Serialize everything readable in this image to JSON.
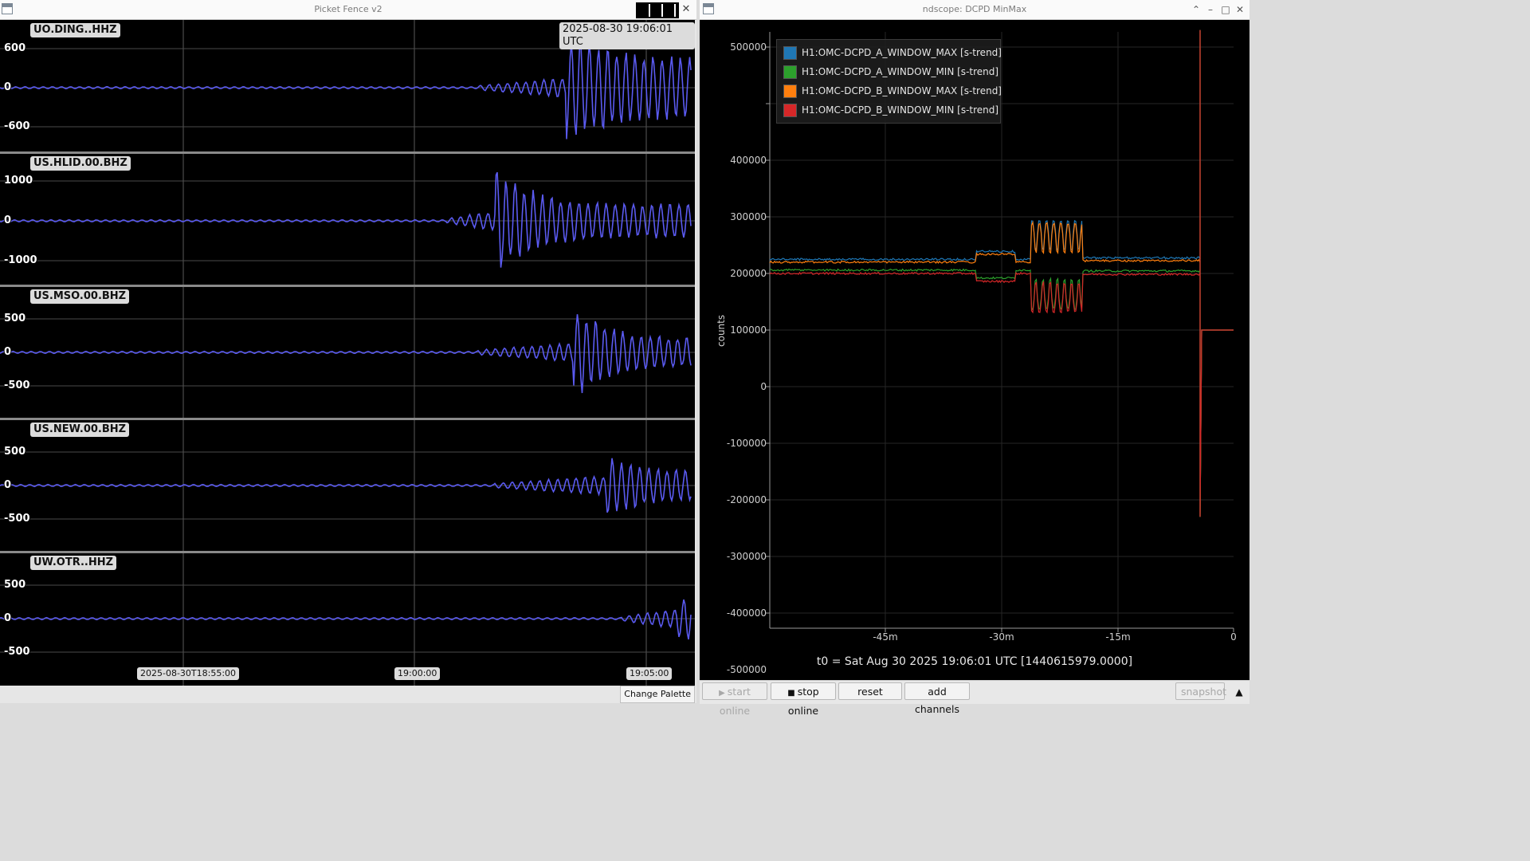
{
  "picket_fence": {
    "window_title": "Picket Fence v2",
    "timestamp": "2025-08-30 19:06:01 UTC",
    "change_palette_label": "Change Palette",
    "trace_color": "#5a5af0",
    "x_ticks": [
      "2025-08-30T18:55:00",
      "19:00:00",
      "19:05:00"
    ],
    "channels": [
      {
        "name": "UO.DING..HHZ",
        "ticks": [
          "600",
          "0",
          "-600"
        ]
      },
      {
        "name": "US.HLID.00.BHZ",
        "ticks": [
          "1000",
          "0",
          "-1000"
        ]
      },
      {
        "name": "US.MSO.00.BHZ",
        "ticks": [
          "500",
          "0",
          "-500"
        ]
      },
      {
        "name": "US.NEW.00.BHZ",
        "ticks": [
          "500",
          "0",
          "-500"
        ]
      },
      {
        "name": "UW.OTR..HHZ",
        "ticks": [
          "500",
          "0",
          "-500"
        ]
      }
    ]
  },
  "ndscope": {
    "window_title": "ndscope: DCPD MinMax",
    "y_axis_label": "counts",
    "y_ticks": [
      "500000",
      "400000",
      "300000",
      "200000",
      "100000",
      "0",
      "-100000",
      "-200000",
      "-300000",
      "-400000",
      "-500000"
    ],
    "x_ticks": [
      "-45m",
      "-30m",
      "-15m",
      "0"
    ],
    "t0_text": "t0 = Sat Aug 30 2025 19:06:01 UTC [1440615979.0000]",
    "legend": [
      {
        "label": "H1:OMC-DCPD_A_WINDOW_MAX [s-trend]",
        "color": "#1f77b4"
      },
      {
        "label": "H1:OMC-DCPD_A_WINDOW_MIN [s-trend]",
        "color": "#2ca02c"
      },
      {
        "label": "H1:OMC-DCPD_B_WINDOW_MAX [s-trend]",
        "color": "#ff7f0e"
      },
      {
        "label": "H1:OMC-DCPD_B_WINDOW_MIN [s-trend]",
        "color": "#d62728"
      }
    ],
    "buttons": {
      "start_online": "start online",
      "stop_online": "stop online",
      "reset": "reset",
      "add_channels": "add channels",
      "snapshot": "snapshot"
    }
  }
}
